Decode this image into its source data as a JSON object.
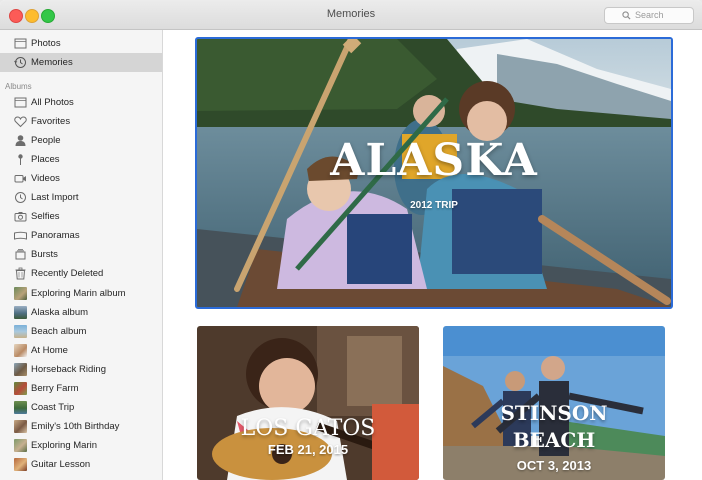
{
  "window": {
    "title": "Memories"
  },
  "search": {
    "placeholder": "Search"
  },
  "sidebar": {
    "top_items": [
      {
        "label": "Photos",
        "icon": "photos-icon"
      },
      {
        "label": "Memories",
        "icon": "memories-icon",
        "selected": true
      }
    ],
    "albums_header": "Albums",
    "albums": [
      {
        "label": "All Photos",
        "icon": "all-photos-icon"
      },
      {
        "label": "Favorites",
        "icon": "heart-icon"
      },
      {
        "label": "People",
        "icon": "person-icon"
      },
      {
        "label": "Places",
        "icon": "pin-icon"
      },
      {
        "label": "Videos",
        "icon": "video-icon"
      },
      {
        "label": "Last Import",
        "icon": "clock-icon"
      },
      {
        "label": "Selfies",
        "icon": "camera-icon"
      },
      {
        "label": "Panoramas",
        "icon": "panorama-icon"
      },
      {
        "label": "Bursts",
        "icon": "bursts-icon"
      },
      {
        "label": "Recently Deleted",
        "icon": "trash-icon"
      },
      {
        "label": "Exploring Marin album",
        "icon": "album-thumbnail"
      },
      {
        "label": "Alaska album",
        "icon": "album-thumbnail"
      },
      {
        "label": "Beach album",
        "icon": "album-thumbnail"
      },
      {
        "label": "At Home",
        "icon": "album-thumbnail"
      },
      {
        "label": "Horseback Riding",
        "icon": "album-thumbnail"
      },
      {
        "label": "Berry Farm",
        "icon": "album-thumbnail"
      },
      {
        "label": "Coast Trip",
        "icon": "album-thumbnail"
      },
      {
        "label": "Emily's 10th Birthday",
        "icon": "album-thumbnail"
      },
      {
        "label": "Exploring Marin",
        "icon": "album-thumbnail"
      },
      {
        "label": "Guitar Lesson",
        "icon": "album-thumbnail"
      }
    ]
  },
  "memories": {
    "featured": {
      "title": "ALASKA",
      "subtitle": "2012 TRIP"
    },
    "cards": [
      {
        "title": "LOS GATOS",
        "subtitle": "FEB 21, 2015"
      },
      {
        "title_line1": "STINSON",
        "title_line2": "BEACH",
        "subtitle": "OCT 3, 2013"
      }
    ]
  },
  "colors": {
    "selection_border": "#2b6bd8",
    "sidebar_bg": "#f5f5f5",
    "sidebar_selected": "#d5d5d5"
  }
}
